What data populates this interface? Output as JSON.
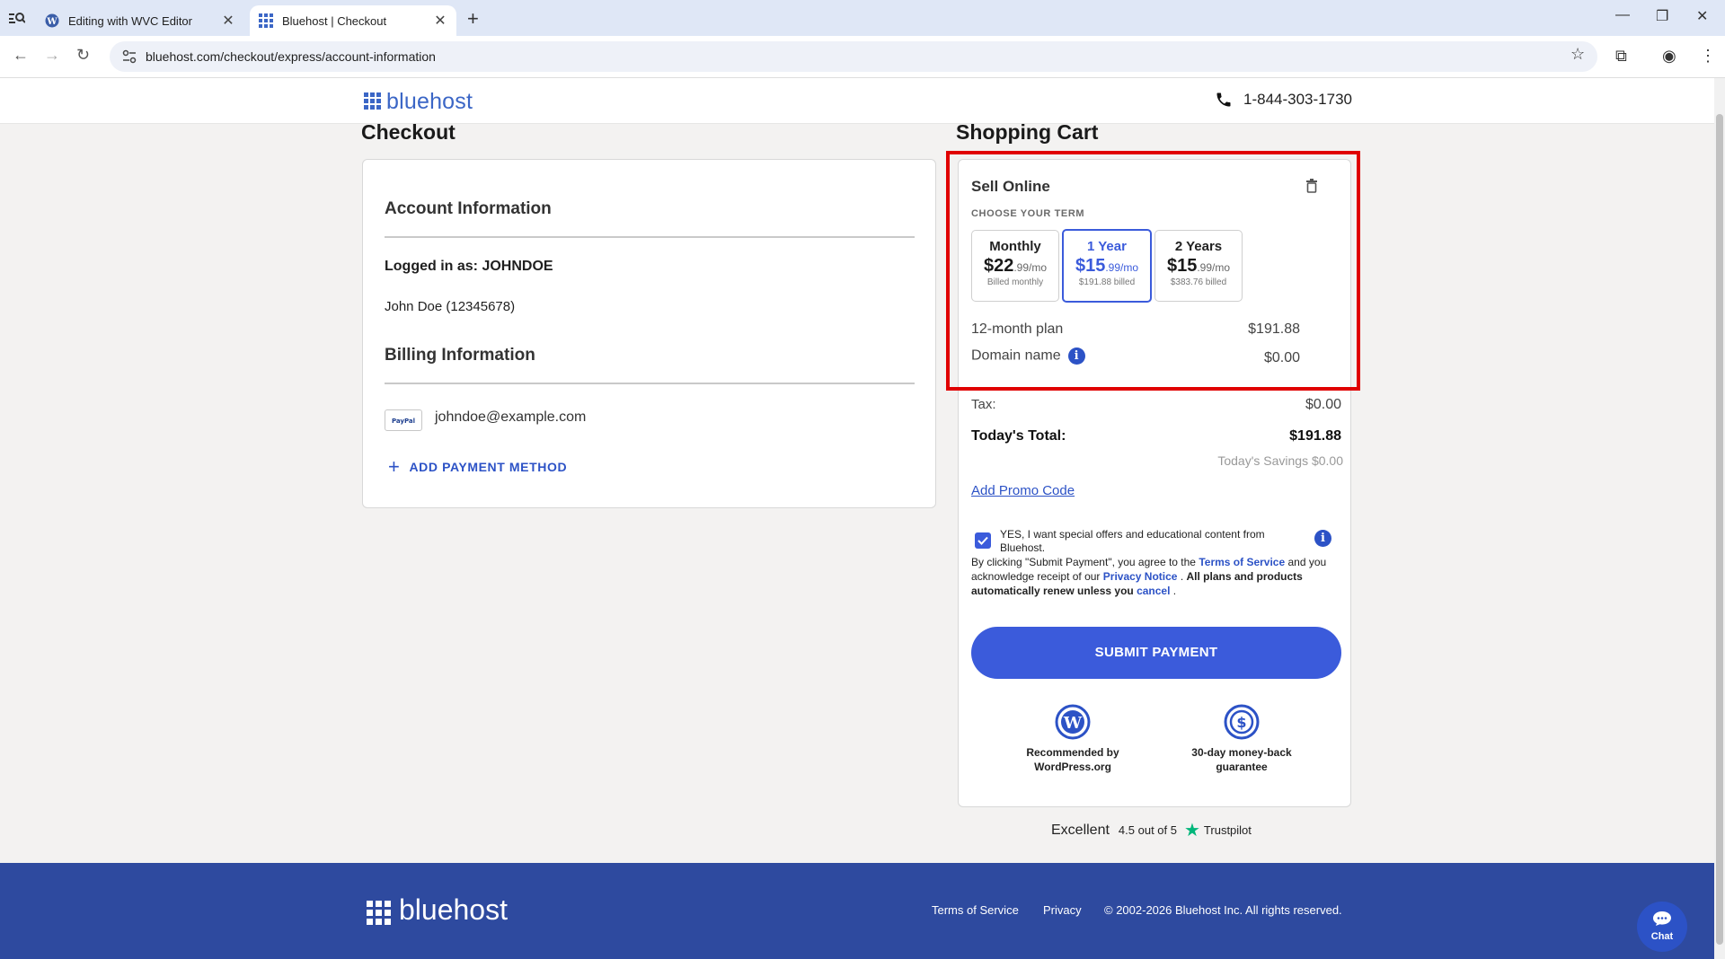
{
  "browser": {
    "tabs": [
      {
        "title": "Editing with WVC Editor",
        "active": false,
        "icon": "wordpress-icon"
      },
      {
        "title": "Bluehost | Checkout",
        "active": true,
        "icon": "bluehost-grid-icon"
      }
    ],
    "url": "bluehost.com/checkout/express/account-information"
  },
  "header": {
    "logo_text": "bluehost",
    "phone": "1-844-303-1730"
  },
  "checkout": {
    "title": "Checkout",
    "account_heading": "Account Information",
    "logged_in": "Logged in as: JOHNDOE",
    "user_line": "John Doe (12345678)",
    "billing_heading": "Billing Information",
    "payment_email": "johndoe@example.com",
    "paypal_badge": "PayPal",
    "add_payment": "ADD PAYMENT METHOD"
  },
  "cart": {
    "title": "Shopping Cart",
    "product": "Sell Online",
    "choose_term": "CHOOSE YOUR TERM",
    "terms": [
      {
        "name": "Monthly",
        "dollars": "22",
        "cents": ".99/mo",
        "billed": "Billed monthly",
        "selected": false
      },
      {
        "name": "1 Year",
        "dollars": "15",
        "cents": ".99/mo",
        "billed": "$191.88 billed",
        "selected": true
      },
      {
        "name": "2 Years",
        "dollars": "15",
        "cents": ".99/mo",
        "billed": "$383.76 billed",
        "selected": false
      }
    ],
    "plan_label": "12-month plan",
    "plan_price": "$191.88",
    "domain_label": "Domain name",
    "domain_price": "$0.00",
    "tax_label": "Tax:",
    "tax_value": "$0.00",
    "total_label": "Today's Total:",
    "total_value": "$191.88",
    "savings": "Today's Savings $0.00",
    "promo": "Add Promo Code",
    "offer_text": "YES, I want special offers and educational content from Bluehost.",
    "legal_1": "By clicking \"Submit Payment\", you agree to the",
    "terms_link": "Terms of Service",
    "legal_2": "and you acknowledge receipt of our",
    "privacy_link": "Privacy Notice",
    "legal_3": "All plans and products automatically renew unless you",
    "cancel_link": "cancel",
    "submit": "SUBMIT PAYMENT",
    "badge_wp": "Recommended by WordPress.org",
    "badge_money": "30-day money-back guarantee"
  },
  "trustpilot": {
    "excellent": "Excellent",
    "rating": "4.5 out of 5",
    "brand": "Trustpilot"
  },
  "footer": {
    "logo_text": "bluehost",
    "terms": "Terms of Service",
    "privacy": "Privacy",
    "copyright": "© 2002-2026 Bluehost Inc. All rights reserved."
  },
  "chat": {
    "label": "Chat"
  },
  "colors": {
    "accent": "#3b5bdb",
    "footer": "#2e4a9f",
    "highlight": "#e00000"
  }
}
